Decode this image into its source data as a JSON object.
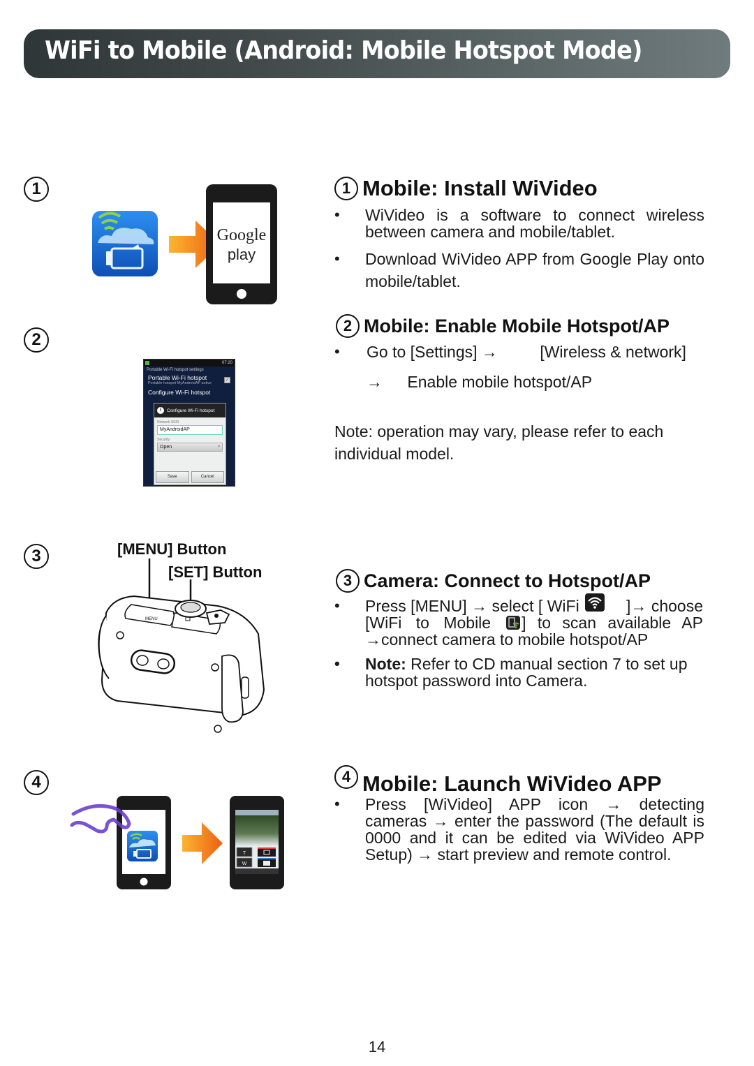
{
  "header": {
    "title": "WiFi to Mobile (Android: Mobile Hotspot Mode)",
    "background_gradient": [
      "#2f3637",
      "#6f7b7c"
    ]
  },
  "steps": [
    {
      "number": "1",
      "title": "Mobile: Install WiVideo",
      "bullets": [
        "WiVideo is a software to connect wireless between camera and mobile/tablet.",
        "Download WiVideo APP from Google Play onto mobile/tablet."
      ],
      "illustration": {
        "description": "WiVideo app icon with orange arrow pointing to phone showing Google play",
        "phone_screen_text": [
          "Google",
          "play"
        ],
        "icons": [
          "wivideo-app-icon",
          "arrow-right-icon",
          "smartphone-icon"
        ]
      }
    },
    {
      "number": "2",
      "title": "Mobile: Enable Mobile Hotspot/AP",
      "bullet": {
        "part1": "Go to [Settings]",
        "arrow": "→",
        "part2": "[Wireless & network]",
        "part3": "Enable mobile hotspot/AP"
      },
      "note": "Note: operation may vary, please refer to each individual model.",
      "screenshot": {
        "status_time": "07:20",
        "header": "Portable Wi-Fi hotspot settings",
        "item1_title": "Portable Wi-Fi hotspot",
        "item1_sub": "Portable hotspot MyAndroidAP active",
        "item2_title": "Configure Wi-Fi hotspot",
        "dialog_title": "Configure Wi-Fi hotspot",
        "ssid_label": "Network SSID",
        "ssid_value": "MyAndroidAP",
        "security_label": "Security",
        "security_value": "Open",
        "save_label": "Save",
        "cancel_label": "Cancel"
      }
    },
    {
      "number": "3",
      "title": "Camera: Connect to Hotspot/AP",
      "bullet1": {
        "a": "Press [MENU] → select [ WiFi",
        "b": "]→ choose",
        "c": "[WiFi to Mobile",
        "d": "] to scan available AP",
        "e": "→connect camera to mobile hotspot/AP"
      },
      "bullet2": {
        "bold": "Note:",
        "text": " Refer to CD manual section 7 to set up hotspot password into Camera."
      },
      "callouts": {
        "menu": "[MENU] Button",
        "set": "[SET] Button",
        "camera_menu_label": "MENU"
      }
    },
    {
      "number": "4",
      "title": "Mobile: Launch WiVideo APP",
      "bullets": [
        "Press [WiVideo] APP icon → detecting cameras → enter the password (The default is 0000 and it can be edited via WiVideo APP Setup) → start preview and remote control."
      ],
      "illustration": {
        "remote_buttons": [
          "T",
          "W"
        ]
      }
    }
  ],
  "bullet_glyph": "•",
  "page_number": "14",
  "colors": {
    "accent_orange": "#f07a1a",
    "app_blue": "#1f6fd1",
    "wifi_green": "#7cc242",
    "hand_purple": "#6a3fd0"
  }
}
